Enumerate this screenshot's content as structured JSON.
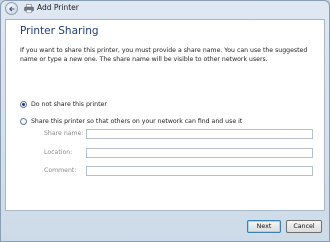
{
  "window": {
    "title": "Add Printer"
  },
  "page": {
    "heading": "Printer Sharing",
    "description": "If you want to share this printer, you must provide a share name. You can use the suggested name or type a new one. The share name will be visible to other network users."
  },
  "options": [
    {
      "label": "Do not share this printer",
      "selected": true
    },
    {
      "label": "Share this printer so that others on your network can find and use it",
      "selected": false
    }
  ],
  "fields": [
    {
      "label": "Share name:",
      "value": ""
    },
    {
      "label": "Location:",
      "value": ""
    },
    {
      "label": "Comment:",
      "value": ""
    }
  ],
  "buttons": {
    "next": "Next",
    "cancel": "Cancel"
  },
  "icons": {
    "back": "back-arrow-icon",
    "title": "printer-icon"
  }
}
